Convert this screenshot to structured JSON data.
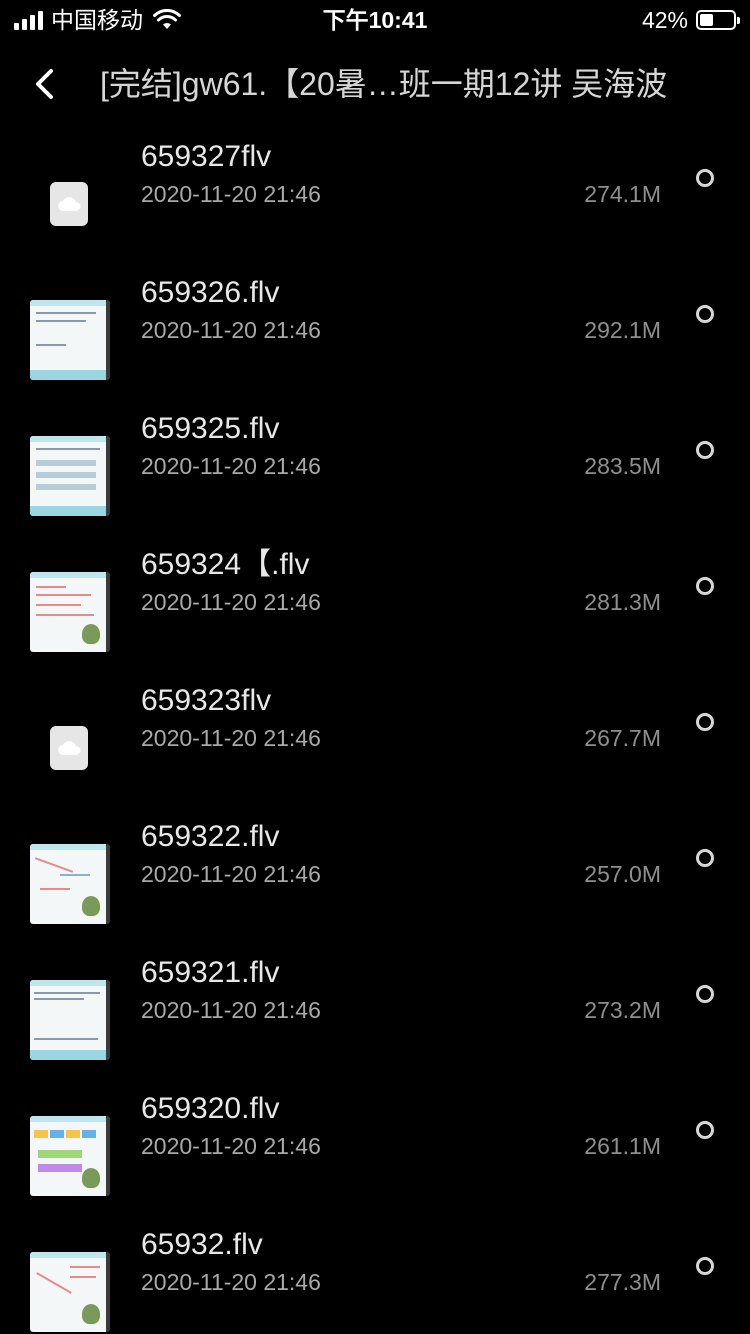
{
  "status_bar": {
    "carrier": "中国移动",
    "time": "下午10:41",
    "battery_percent": "42%",
    "battery_level": 0.42
  },
  "nav": {
    "back_icon": "chevron-left-icon",
    "title": "[完结]gw61.【20暑…班一期12讲 吴海波"
  },
  "files": [
    {
      "name": "659327flv",
      "date": "2020-11-20 21:46",
      "size": "274.1M",
      "thumb": "cloud"
    },
    {
      "name": "659326.flv",
      "date": "2020-11-20 21:46",
      "size": "292.1M",
      "thumb": "video-a"
    },
    {
      "name": "659325.flv",
      "date": "2020-11-20 21:46",
      "size": "283.5M",
      "thumb": "video-b"
    },
    {
      "name": "659324【.flv",
      "date": "2020-11-20 21:46",
      "size": "281.3M",
      "thumb": "video-c"
    },
    {
      "name": "659323flv",
      "date": "2020-11-20 21:46",
      "size": "267.7M",
      "thumb": "cloud"
    },
    {
      "name": "659322.flv",
      "date": "2020-11-20 21:46",
      "size": "257.0M",
      "thumb": "video-d"
    },
    {
      "name": "659321.flv",
      "date": "2020-11-20 21:46",
      "size": "273.2M",
      "thumb": "video-e"
    },
    {
      "name": "659320.flv",
      "date": "2020-11-20 21:46",
      "size": "261.1M",
      "thumb": "video-f"
    },
    {
      "name": "65932.flv",
      "date": "2020-11-20 21:46",
      "size": "277.3M",
      "thumb": "video-g"
    }
  ]
}
